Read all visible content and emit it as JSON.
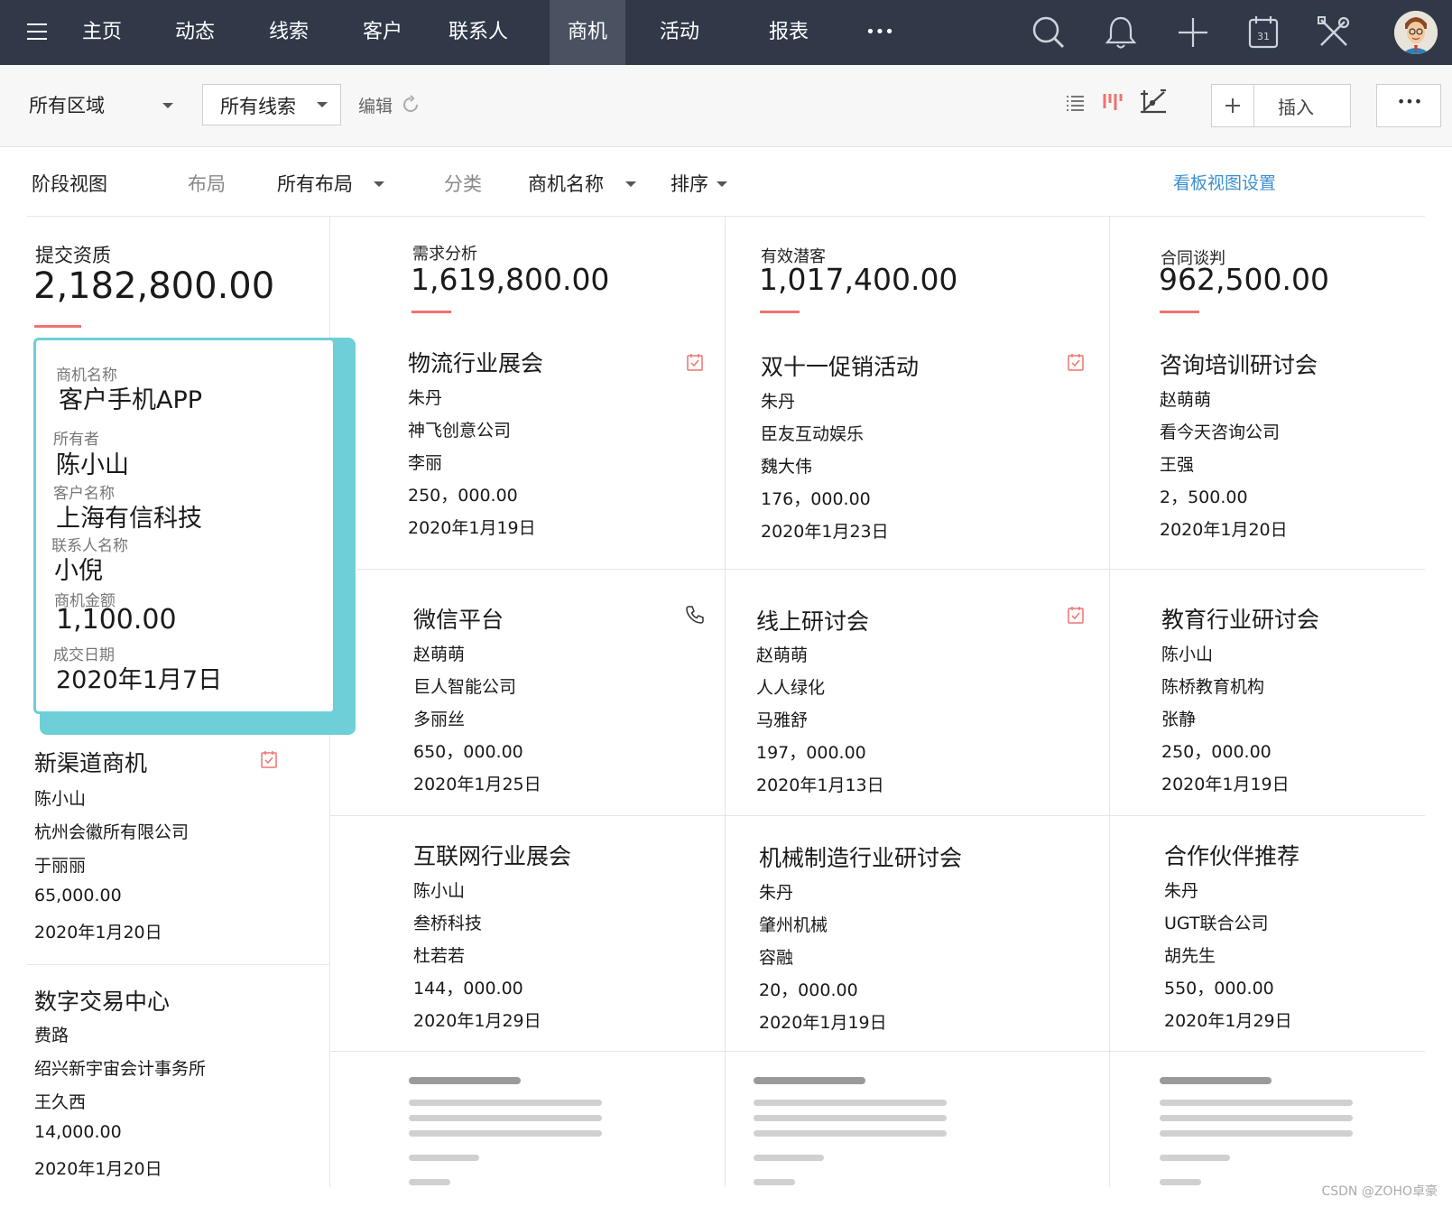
{
  "nav": {
    "items": [
      "主页",
      "动态",
      "线索",
      "客户",
      "联系人",
      "商机",
      "活动",
      "报表"
    ],
    "active_index": 5,
    "more_label": "•••"
  },
  "toolbar": {
    "region_label": "所有区域",
    "filter_label": "所有线索",
    "edit_label": "编辑",
    "insert_label": "插入",
    "more_label": "•••"
  },
  "viewbar": {
    "stage_view": "阶段视图",
    "layout_label": "布局",
    "layout_value": "所有布局",
    "category_label": "分类",
    "category_value": "商机名称",
    "sort_label": "排序",
    "kanban_settings": "看板视图设置"
  },
  "columns": [
    {
      "stage": "提交资质",
      "total": "2,182,800.00",
      "cards": [
        {
          "title": "新渠道商机",
          "owner": "陈小山",
          "company": "杭州会徽所有限公司",
          "contact": "于丽丽",
          "amount": "65,000.00",
          "date": "2020年1月20日"
        },
        {
          "title": "数字交易中心",
          "owner": "费路",
          "company": "绍兴新宇宙会计事务所",
          "contact": "王久西",
          "amount": "14,000.00",
          "date": "2020年1月20日"
        }
      ]
    },
    {
      "stage": "需求分析",
      "total": "1,619,800.00",
      "cards": [
        {
          "title": "物流行业展会",
          "owner": "朱丹",
          "company": "神飞创意公司",
          "contact": "李丽",
          "amount": "250，000.00",
          "date": "2020年1月19日"
        },
        {
          "title": "微信平台",
          "owner": "赵萌萌",
          "company": "巨人智能公司",
          "contact": "多丽丝",
          "amount": "650，000.00",
          "date": "2020年1月25日"
        },
        {
          "title": "互联网行业展会",
          "owner": "陈小山",
          "company": "叁桥科技",
          "contact": "杜若若",
          "amount": "144，000.00",
          "date": "2020年1月29日"
        }
      ]
    },
    {
      "stage": "有效潜客",
      "total": "1,017,400.00",
      "cards": [
        {
          "title": "双十一促销活动",
          "owner": "朱丹",
          "company": "臣友互动娱乐",
          "contact": "魏大伟",
          "amount": "176，000.00",
          "date": "2020年1月23日"
        },
        {
          "title": "线上研讨会",
          "owner": "赵萌萌",
          "company": "人人绿化",
          "contact": "马雅舒",
          "amount": "197，000.00",
          "date": "2020年1月13日"
        },
        {
          "title": "机械制造行业研讨会",
          "owner": "朱丹",
          "company": "肇州机械",
          "contact": "容融",
          "amount": "20，000.00",
          "date": "2020年1月19日"
        }
      ]
    },
    {
      "stage": "合同谈判",
      "total": "962,500.00",
      "cards": [
        {
          "title": "咨询培训研讨会",
          "owner": "赵萌萌",
          "company": "看今天咨询公司",
          "contact": "王强",
          "amount": "2，500.00",
          "date": "2020年1月20日"
        },
        {
          "title": "教育行业研讨会",
          "owner": "陈小山",
          "company": "陈桥教育机构",
          "contact": "张静",
          "amount": "250，000.00",
          "date": "2020年1月19日"
        },
        {
          "title": "合作伙伴推荐",
          "owner": "朱丹",
          "company": "UGT联合公司",
          "contact": "胡先生",
          "amount": "550，000.00",
          "date": "2020年1月29日"
        }
      ]
    }
  ],
  "dragged_card": {
    "name_label": "商机名称",
    "name": "客户手机APP",
    "owner_label": "所有者",
    "owner": "陈小山",
    "account_label": "客户名称",
    "account": "上海有信科技",
    "contact_label": "联系人名称",
    "contact": "小倪",
    "amount_label": "商机金额",
    "amount": "1,100.00",
    "date_label": "成交日期",
    "date": "2020年1月7日"
  },
  "watermark": "CSDN @ZOHO卓豪",
  "colors": {
    "topbar": "#313949",
    "accent_red": "#f0736f",
    "drag_teal": "#6fcfd8",
    "link_blue": "#3a8fd1"
  }
}
